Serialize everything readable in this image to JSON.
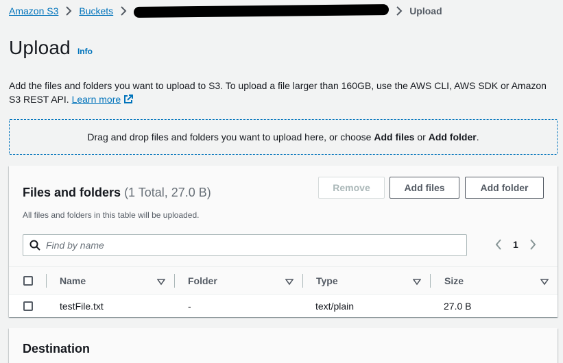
{
  "breadcrumb": {
    "items": [
      "Amazon S3",
      "Buckets"
    ],
    "redacted_icon": "redacted-bucket-name",
    "current": "Upload"
  },
  "header": {
    "title": "Upload",
    "info": "Info"
  },
  "description": {
    "text": "Add the files and folders you want to upload to S3. To upload a file larger than 160GB, use the AWS CLI, AWS SDK or Amazon S3 REST API.",
    "learn_more": "Learn more"
  },
  "dropzone": {
    "prefix": "Drag and drop files and folders you want to upload here, or choose",
    "add_files": "Add files",
    "or": "or",
    "add_folder": "Add folder",
    "suffix": "."
  },
  "files_panel": {
    "title": "Files and folders",
    "count": "(1 Total, 27.0 B)",
    "description": "All files and folders in this table will be uploaded.",
    "buttons": {
      "remove": "Remove",
      "add_files": "Add files",
      "add_folder": "Add folder"
    },
    "search": {
      "placeholder": "Find by name",
      "value": ""
    },
    "pagination": {
      "current_page": "1"
    },
    "columns": [
      "Name",
      "Folder",
      "Type",
      "Size"
    ],
    "rows": [
      {
        "name": "testFile.txt",
        "folder": "-",
        "type": "text/plain",
        "size": "27.0 B"
      }
    ]
  },
  "destination": {
    "title": "Destination"
  },
  "colors": {
    "link": "#0073bb",
    "background": "#f2f3f3",
    "text": "#16191f",
    "secondary_text": "#545b64",
    "disabled": "#aab7b8"
  }
}
